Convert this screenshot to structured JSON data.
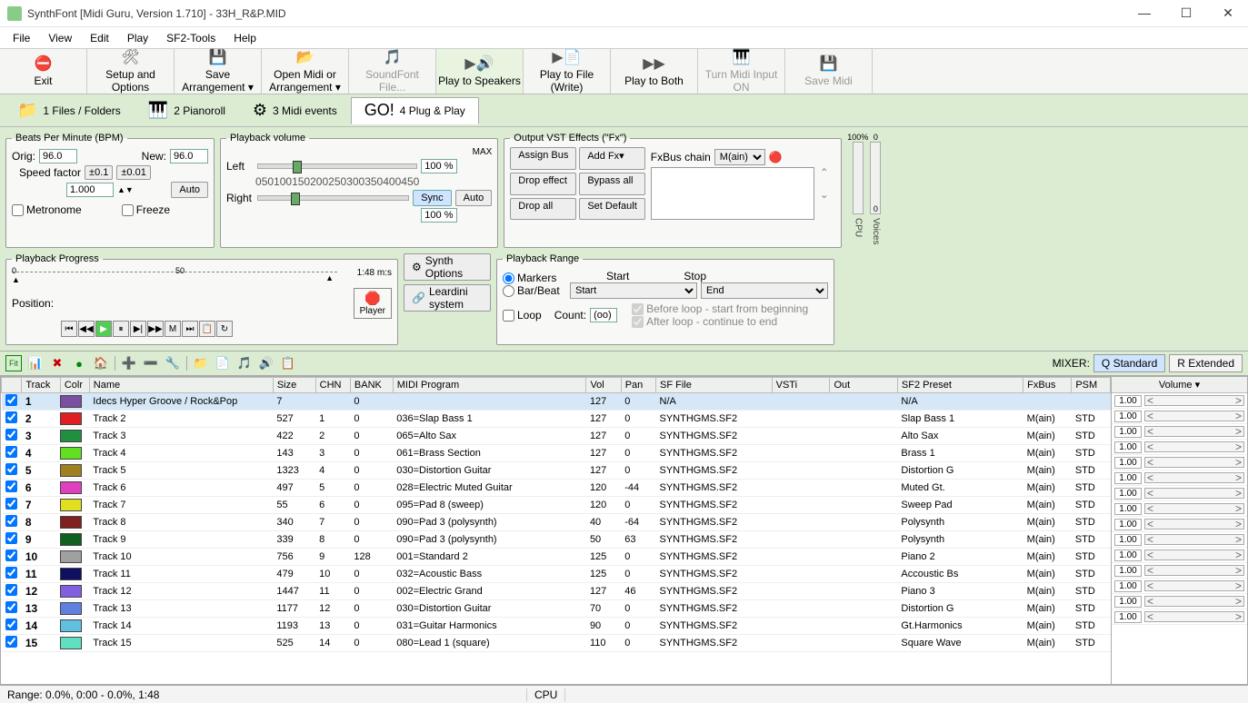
{
  "window": {
    "title": "SynthFont [Midi Guru, Version 1.710] - 33H_R&P.MID"
  },
  "menu": [
    "File",
    "View",
    "Edit",
    "Play",
    "SF2-Tools",
    "Help"
  ],
  "toolbar": [
    {
      "label": "Exit",
      "icon": "⛔",
      "color": "#c00"
    },
    {
      "label": "Setup and Options",
      "icon": "🛠"
    },
    {
      "label": "Save Arrangement ▾",
      "icon": "💾"
    },
    {
      "label": "Open Midi or Arrangement ▾",
      "icon": "📂"
    },
    {
      "label": "SoundFont File...",
      "icon": "🎵",
      "disabled": true
    },
    {
      "label": "Play to Speakers",
      "icon": "▶🔊",
      "highlight": true
    },
    {
      "label": "Play to File (Write)",
      "icon": "▶📄"
    },
    {
      "label": "Play to Both",
      "icon": "▶▶"
    },
    {
      "label": "Turn Midi Input ON",
      "icon": "🎹",
      "disabled": true
    },
    {
      "label": "Save Midi",
      "icon": "💾",
      "disabled": true
    }
  ],
  "tabs": [
    {
      "label": "1 Files / Folders",
      "icon": "📁"
    },
    {
      "label": "2 Pianoroll",
      "icon": "🎹"
    },
    {
      "label": "3 Midi events",
      "icon": "⚙"
    },
    {
      "label": "4 Plug & Play",
      "icon": "GO!",
      "active": true
    }
  ],
  "bpm": {
    "legend": "Beats Per Minute (BPM)",
    "orig_label": "Orig:",
    "orig": "96.0",
    "new_label": "New:",
    "new": "96.0",
    "speed_label": "Speed factor",
    "pm01a": "±0.1",
    "pm01b": "±0.01",
    "speed": "1.000",
    "auto": "Auto",
    "metronome": "Metronome",
    "freeze": "Freeze"
  },
  "volume": {
    "legend": "Playback volume",
    "max": "MAX",
    "left": "Left",
    "right": "Right",
    "pct_top": "100 %",
    "pct_bot": "100 %",
    "sync": "Sync",
    "auto": "Auto",
    "scale": [
      "0",
      "50",
      "100",
      "150",
      "200",
      "250",
      "300",
      "350",
      "400",
      "450"
    ]
  },
  "vst": {
    "legend": "Output VST Effects (\"Fx\")",
    "assign": "Assign Bus",
    "addfx": "Add Fx▾",
    "drop": "Drop effect",
    "bypass": "Bypass all",
    "dropall": "Drop all",
    "setdef": "Set Default",
    "chain_label": "FxBus chain",
    "chain": "M(ain)"
  },
  "progress": {
    "legend": "Playback Progress",
    "time": "1:48 m:s",
    "position": "Position:",
    "ticks": [
      "0",
      "50"
    ],
    "player": "Player"
  },
  "synth": {
    "opts": "Synth Options",
    "lear": "Leardini system"
  },
  "range": {
    "legend": "Playback Range",
    "markers": "Markers",
    "barbeat": "Bar/Beat",
    "start_h": "Start",
    "stop_h": "Stop",
    "start": "Start",
    "end": "End",
    "loop": "Loop",
    "count_label": "Count:",
    "count": "(oo)",
    "before": "Before loop - start from beginning",
    "after": "After loop - continue to end"
  },
  "meters": {
    "cpu": "CPU",
    "voices": "Voices",
    "pct": "100%",
    "zero": "0"
  },
  "mixer": {
    "label": "MIXER:",
    "std": "Q Standard",
    "ext": "R Extended"
  },
  "track_headers": [
    "",
    "Track",
    "Colr",
    "Name",
    "Size",
    "CHN",
    "BANK",
    "MIDI Program",
    "Vol",
    "Pan",
    "SF File",
    "VSTi",
    "Out",
    "SF2 Preset",
    "FxBus",
    "PSM"
  ],
  "vol_header": "Volume ▾",
  "tracks": [
    {
      "n": "1",
      "c": "#7a4ea0",
      "name": "Idecs Hyper Groove / Rock&Pop",
      "size": "7",
      "chn": "",
      "bank": "0",
      "prog": "",
      "vol": "127",
      "pan": "0",
      "sf": "N/A",
      "preset": "N/A",
      "bus": "",
      "psm": "",
      "sel": true
    },
    {
      "n": "2",
      "c": "#e02020",
      "name": "Track 2",
      "size": "527",
      "chn": "1",
      "bank": "0",
      "prog": "036=Slap Bass 1",
      "vol": "127",
      "pan": "0",
      "sf": "SYNTHGMS.SF2",
      "preset": "Slap Bass 1",
      "bus": "M(ain)",
      "psm": "STD"
    },
    {
      "n": "3",
      "c": "#209040",
      "name": "Track 3",
      "size": "422",
      "chn": "2",
      "bank": "0",
      "prog": "065=Alto Sax",
      "vol": "127",
      "pan": "0",
      "sf": "SYNTHGMS.SF2",
      "preset": "Alto Sax",
      "bus": "M(ain)",
      "psm": "STD"
    },
    {
      "n": "4",
      "c": "#60e020",
      "name": "Track 4",
      "size": "143",
      "chn": "3",
      "bank": "0",
      "prog": "061=Brass Section",
      "vol": "127",
      "pan": "0",
      "sf": "SYNTHGMS.SF2",
      "preset": "Brass 1",
      "bus": "M(ain)",
      "psm": "STD"
    },
    {
      "n": "5",
      "c": "#a08020",
      "name": "Track 5",
      "size": "1323",
      "chn": "4",
      "bank": "0",
      "prog": "030=Distortion Guitar",
      "vol": "127",
      "pan": "0",
      "sf": "SYNTHGMS.SF2",
      "preset": "Distortion G",
      "bus": "M(ain)",
      "psm": "STD"
    },
    {
      "n": "6",
      "c": "#e040c0",
      "name": "Track 6",
      "size": "497",
      "chn": "5",
      "bank": "0",
      "prog": "028=Electric Muted Guitar",
      "vol": "120",
      "pan": "-44",
      "sf": "SYNTHGMS.SF2",
      "preset": "Muted Gt.",
      "bus": "M(ain)",
      "psm": "STD"
    },
    {
      "n": "7",
      "c": "#e0e020",
      "name": "Track 7",
      "size": "55",
      "chn": "6",
      "bank": "0",
      "prog": "095=Pad 8 (sweep)",
      "vol": "120",
      "pan": "0",
      "sf": "SYNTHGMS.SF2",
      "preset": "Sweep Pad",
      "bus": "M(ain)",
      "psm": "STD"
    },
    {
      "n": "8",
      "c": "#802020",
      "name": "Track 8",
      "size": "340",
      "chn": "7",
      "bank": "0",
      "prog": "090=Pad 3 (polysynth)",
      "vol": "40",
      "pan": "-64",
      "sf": "SYNTHGMS.SF2",
      "preset": "Polysynth",
      "bus": "M(ain)",
      "psm": "STD"
    },
    {
      "n": "9",
      "c": "#106020",
      "name": "Track 9",
      "size": "339",
      "chn": "8",
      "bank": "0",
      "prog": "090=Pad 3 (polysynth)",
      "vol": "50",
      "pan": "63",
      "sf": "SYNTHGMS.SF2",
      "preset": "Polysynth",
      "bus": "M(ain)",
      "psm": "STD"
    },
    {
      "n": "10",
      "c": "#a0a0a0",
      "name": "Track 10",
      "size": "756",
      "chn": "9",
      "bank": "128",
      "prog": "001=Standard 2",
      "vol": "125",
      "pan": "0",
      "sf": "SYNTHGMS.SF2",
      "preset": "Piano 2",
      "bus": "M(ain)",
      "psm": "STD"
    },
    {
      "n": "11",
      "c": "#101060",
      "name": "Track 11",
      "size": "479",
      "chn": "10",
      "bank": "0",
      "prog": "032=Acoustic Bass",
      "vol": "125",
      "pan": "0",
      "sf": "SYNTHGMS.SF2",
      "preset": "Accoustic Bs",
      "bus": "M(ain)",
      "psm": "STD"
    },
    {
      "n": "12",
      "c": "#8060e0",
      "name": "Track 12",
      "size": "1447",
      "chn": "11",
      "bank": "0",
      "prog": "002=Electric Grand",
      "vol": "127",
      "pan": "46",
      "sf": "SYNTHGMS.SF2",
      "preset": "Piano 3",
      "bus": "M(ain)",
      "psm": "STD"
    },
    {
      "n": "13",
      "c": "#6080e0",
      "name": "Track 13",
      "size": "1177",
      "chn": "12",
      "bank": "0",
      "prog": "030=Distortion Guitar",
      "vol": "70",
      "pan": "0",
      "sf": "SYNTHGMS.SF2",
      "preset": "Distortion G",
      "bus": "M(ain)",
      "psm": "STD"
    },
    {
      "n": "14",
      "c": "#60c0e0",
      "name": "Track 14",
      "size": "1193",
      "chn": "13",
      "bank": "0",
      "prog": "031=Guitar Harmonics",
      "vol": "90",
      "pan": "0",
      "sf": "SYNTHGMS.SF2",
      "preset": "Gt.Harmonics",
      "bus": "M(ain)",
      "psm": "STD"
    },
    {
      "n": "15",
      "c": "#60e0c0",
      "name": "Track 15",
      "size": "525",
      "chn": "14",
      "bank": "0",
      "prog": "080=Lead 1 (square)",
      "vol": "110",
      "pan": "0",
      "sf": "SYNTHGMS.SF2",
      "preset": "Square Wave",
      "bus": "M(ain)",
      "psm": "STD"
    }
  ],
  "vol_default": "1.00",
  "status": {
    "range": "Range: 0.0%, 0:00 - 0.0%, 1:48",
    "cpu": "CPU"
  }
}
